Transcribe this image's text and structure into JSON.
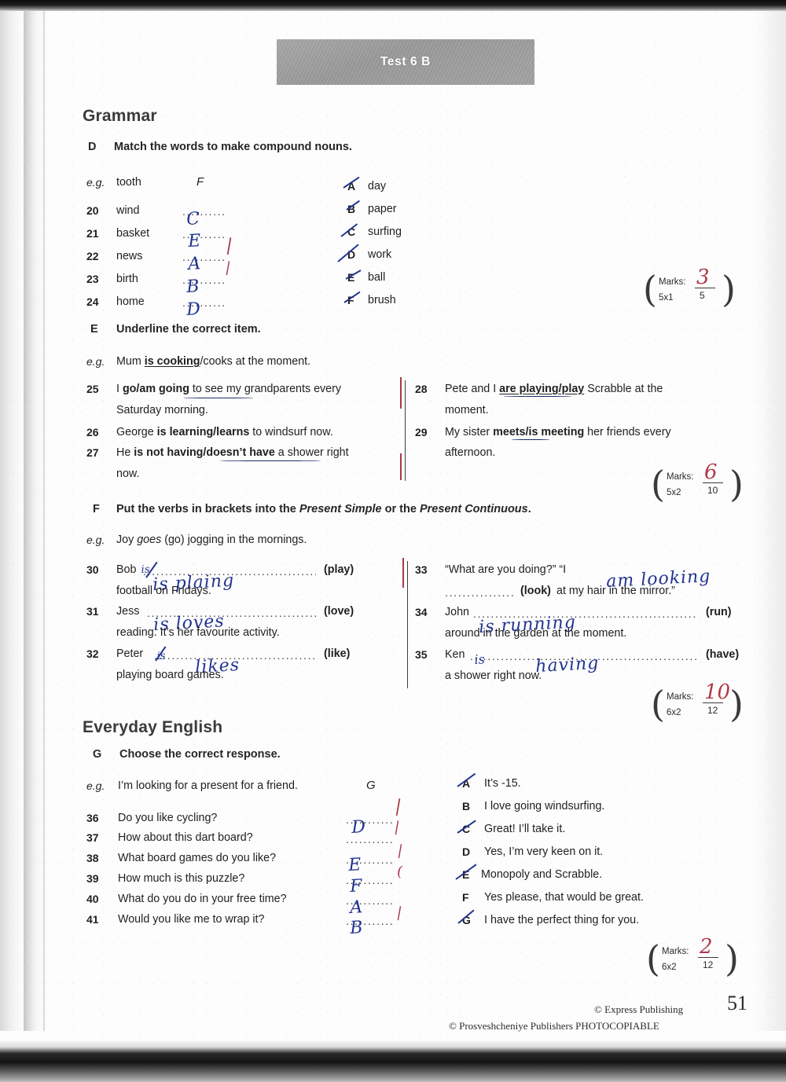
{
  "banner": {
    "title": "Test 6 B"
  },
  "sections": {
    "grammar_heading": "Grammar",
    "everyday_heading": "Everyday English"
  },
  "exercise_d": {
    "letter": "D",
    "rubric": "Match the words to make compound nouns.",
    "eg_label": "e.g.",
    "eg_word": "tooth",
    "eg_answer": "F",
    "left_items": [
      {
        "num": "20",
        "word": "wind",
        "answer": "C"
      },
      {
        "num": "21",
        "word": "basket",
        "answer": "E"
      },
      {
        "num": "22",
        "word": "news",
        "answer": "A"
      },
      {
        "num": "23",
        "word": "birth",
        "answer": "B"
      },
      {
        "num": "24",
        "word": "home",
        "answer": "D"
      }
    ],
    "right_options": [
      {
        "letter": "A",
        "word": "day"
      },
      {
        "letter": "B",
        "word": "paper"
      },
      {
        "letter": "C",
        "word": "surfing"
      },
      {
        "letter": "D",
        "word": "work"
      },
      {
        "letter": "E",
        "word": "ball"
      },
      {
        "letter": "F",
        "word": "brush"
      }
    ],
    "marks": {
      "label": "Marks:",
      "multiplier": "5x1",
      "total": "5",
      "score": "3"
    }
  },
  "exercise_e": {
    "letter": "E",
    "rubric": "Underline the correct item.",
    "eg_label": "e.g.",
    "eg_pre": "Mum ",
    "eg_underlined": "is cooking",
    "eg_post": "/cooks at the moment.",
    "items": [
      {
        "num": "25",
        "line1_pre": "I ",
        "line1_bold": "go/am going",
        "line1_post": " to see my grandparents every",
        "line2": "Saturday morning."
      },
      {
        "num": "26",
        "line1_pre": "George ",
        "line1_bold": "is learning/learns",
        "line1_post": " to windsurf now.",
        "line2": ""
      },
      {
        "num": "27",
        "line1_pre": "He ",
        "line1_bold": "is not having/doesn’t have",
        "line1_post": " a shower right",
        "line2": "now."
      },
      {
        "num": "28",
        "line1_pre": "Pete and I ",
        "line1_bold": "are playing/play",
        "line1_post": " Scrabble at the",
        "line2": "moment."
      },
      {
        "num": "29",
        "line1_pre": "My sister ",
        "line1_bold": "meets/is meeting",
        "line1_post": " her friends every",
        "line2": "afternoon."
      }
    ],
    "marks": {
      "label": "Marks:",
      "multiplier": "5x2",
      "total": "10",
      "score": "6"
    }
  },
  "exercise_f": {
    "letter": "F",
    "rubric_pre": "Put the verbs in brackets into the ",
    "rubric_i1": "Present Simple",
    "rubric_mid": " or the ",
    "rubric_i2": "Present Continuous",
    "rubric_post": ".",
    "eg_label": "e.g.",
    "eg_pre": "Joy ",
    "eg_italic": "goes",
    "eg_post": " (go) jogging in the mornings.",
    "items": [
      {
        "num": "30",
        "subject": "Bob",
        "verb_hint": "(play)",
        "line2": "football on Fridays.",
        "answer": "is plaing",
        "answer_extra": "is"
      },
      {
        "num": "31",
        "subject": "Jess",
        "verb_hint": "(love)",
        "line2": "reading. It’s her favourite activity.",
        "answer": "is loves"
      },
      {
        "num": "32",
        "subject": "Peter",
        "verb_hint": "(like)",
        "line2": "playing board games.",
        "answer": "likes",
        "answer_extra": "is"
      },
      {
        "num": "33",
        "subject": "“What are you doing?” “I",
        "verb_hint": "(look)",
        "line2": "at my hair in the mirror.”",
        "answer": "am looking"
      },
      {
        "num": "34",
        "subject": "John",
        "verb_hint": "(run)",
        "line2": "around in the garden at the moment.",
        "answer": "is running",
        "answer_extra": "is"
      },
      {
        "num": "35",
        "subject": "Ken",
        "verb_hint": "(have)",
        "line2": "a shower right now.",
        "answer": "having",
        "answer_extra": "is"
      }
    ],
    "marks": {
      "label": "Marks:",
      "multiplier": "6x2",
      "total": "12",
      "score": "10"
    }
  },
  "exercise_g": {
    "letter": "G",
    "rubric": "Choose the correct response.",
    "eg_label": "e.g.",
    "eg_text": "I’m looking for a present for a friend.",
    "eg_answer": "G",
    "questions": [
      {
        "num": "36",
        "text": "Do you like cycling?",
        "answer": "D"
      },
      {
        "num": "37",
        "text": "How about this dart board?",
        "answer": ""
      },
      {
        "num": "38",
        "text": "What board games do you like?",
        "answer": "E"
      },
      {
        "num": "39",
        "text": "How much is this puzzle?",
        "answer": "F"
      },
      {
        "num": "40",
        "text": "What do you do in your free time?",
        "answer": "A"
      },
      {
        "num": "41",
        "text": "Would you like me to wrap it?",
        "answer": "B"
      }
    ],
    "responses": [
      {
        "letter": "A",
        "text": "It’s -15."
      },
      {
        "letter": "B",
        "text": "I love going windsurfing."
      },
      {
        "letter": "C",
        "text": "Great! I’ll take it."
      },
      {
        "letter": "D",
        "text": "Yes, I’m very keen on it."
      },
      {
        "letter": "E",
        "text": "Monopoly and Scrabble."
      },
      {
        "letter": "F",
        "text": "Yes please, that would be great."
      },
      {
        "letter": "G",
        "text": "I have the perfect thing for you."
      }
    ],
    "marks": {
      "label": "Marks:",
      "multiplier": "6x2",
      "total": "12",
      "score": "2"
    }
  },
  "footer": {
    "line1": "© Express Publishing",
    "line2": "© Prosveshcheniye Publishers PHOTOCOPIABLE",
    "page_number": "51"
  },
  "colors": {
    "banner_gray": "#a3a3a3",
    "pen_blue": "#22348f",
    "pen_red": "#b03a4a",
    "text": "#1f1f1f"
  }
}
